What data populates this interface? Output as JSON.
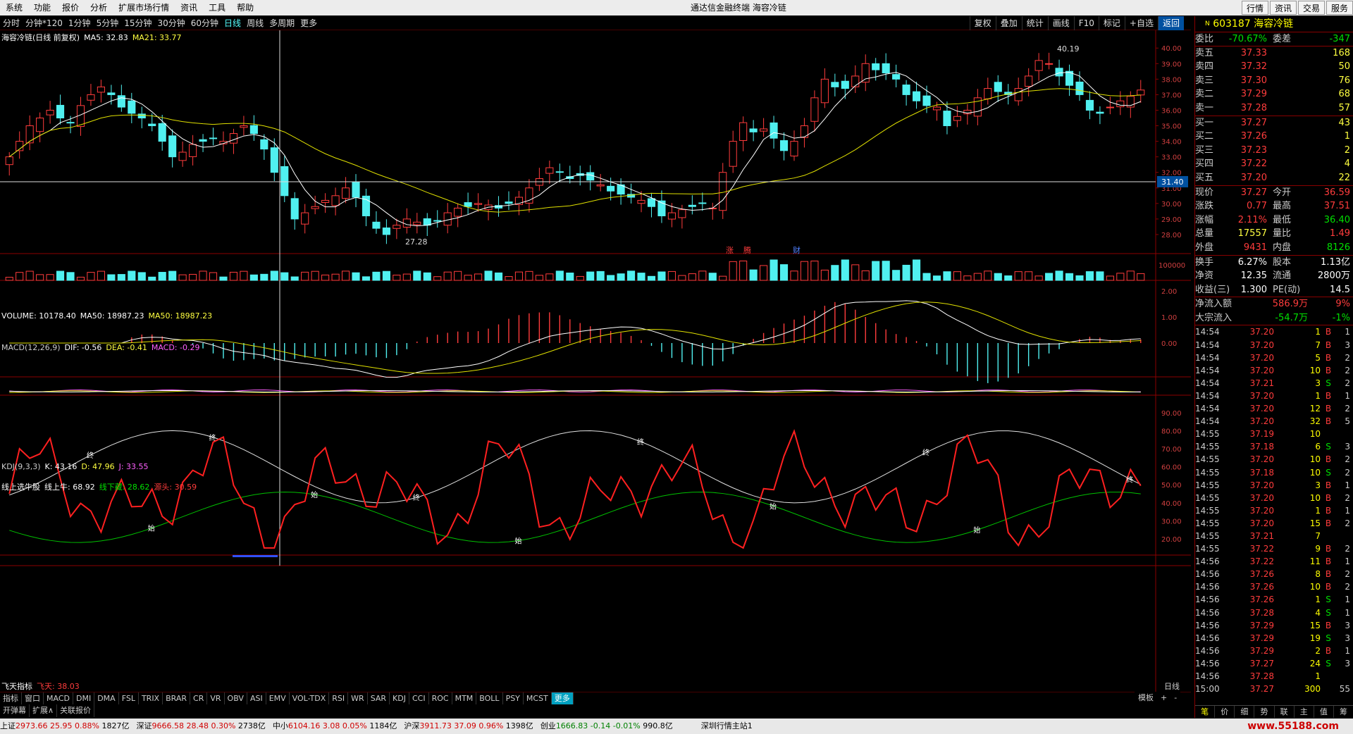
{
  "menubar": {
    "items": [
      "系统",
      "功能",
      "报价",
      "分析",
      "扩展市场行情",
      "资讯",
      "工具",
      "帮助"
    ],
    "title": "通达信金融终端  海容冷链",
    "right_buttons": [
      "行情",
      "资讯",
      "交易",
      "服务"
    ]
  },
  "periods": {
    "items": [
      "分时",
      "分钟*120",
      "1分钟",
      "5分钟",
      "15分钟",
      "30分钟",
      "60分钟",
      "日线",
      "周线",
      "多周期",
      "更多"
    ],
    "active": "日线"
  },
  "toolbar": {
    "items": [
      "复权",
      "叠加",
      "统计",
      "画线",
      "F10",
      "标记",
      "+自选",
      "返回"
    ],
    "active": "返回"
  },
  "main_chart": {
    "title_stock": "海容冷链(日线 前复权)",
    "ma5": "MA5: 32.83",
    "ma21": "MA21: 33.77",
    "price_axis": [
      "40.00",
      "39.00",
      "38.00",
      "37.00",
      "36.00",
      "35.00",
      "34.00",
      "33.00",
      "32.00",
      "31.00",
      "30.00",
      "29.00",
      "28.00"
    ],
    "cursor_price": "31.40",
    "high_label": "40.19",
    "low_label": "27.28",
    "markers": [
      "涨",
      "腾",
      "财"
    ]
  },
  "volume_panel": {
    "title": "VOLUME: 10178.40",
    "ma50a": "MA50: 18987.23",
    "ma50b": "MA50: 18987.23",
    "axis": "100000"
  },
  "macd_panel": {
    "title": "MACD(12,26,9)",
    "dif": "DIF: -0.56",
    "dea": "DEA: -0.41",
    "macd": "MACD: -0.29",
    "axis": [
      "2.00",
      "1.00",
      "0.00"
    ]
  },
  "kdj_panel": {
    "title": "KDJ(9,3,3)",
    "k": "K: 43.16",
    "d": "D: 47.96",
    "j": "J: 33.55"
  },
  "niu_panel": {
    "title": "线上选牛股",
    "up": "线上牛: 68.92",
    "down": "线下藏: 28.62",
    "head": "源头: 30.59",
    "axis": [
      "90.00",
      "80.00",
      "70.00",
      "60.00",
      "50.00",
      "40.00",
      "30.00",
      "20.00"
    ],
    "labels_start": "始",
    "labels_end": "终"
  },
  "feitian_panel": {
    "title": "飞天指标",
    "value": "飞天: 38.03"
  },
  "bottom_tabs": [
    "指标",
    "窗口",
    "MACD",
    "DMI",
    "DMA",
    "FSL",
    "TRIX",
    "BRAR",
    "CR",
    "VR",
    "OBV",
    "ASI",
    "EMV",
    "VOL-TDX",
    "RSI",
    "WR",
    "SAR",
    "KDJ",
    "CCI",
    "ROC",
    "MTM",
    "BOLL",
    "PSY",
    "MCST",
    "更多"
  ],
  "bottom_tabs_right": [
    "模板",
    "+",
    "-"
  ],
  "bottom_tabs_row2": [
    "开弹幕",
    "扩展∧",
    "关联报价"
  ],
  "period_label_right": "日线",
  "statusbar": [
    {
      "name": "上证",
      "v": "2973.66",
      "c": "25.95",
      "p": "0.88%",
      "a": "1827亿",
      "color": "red"
    },
    {
      "name": "深证",
      "v": "9666.58",
      "c": "28.48",
      "p": "0.30%",
      "a": "2738亿",
      "color": "red"
    },
    {
      "name": "中小",
      "v": "6104.16",
      "c": "3.08",
      "p": "0.05%",
      "a": "1184亿",
      "color": "red"
    },
    {
      "name": "沪深",
      "v": "3911.73",
      "c": "37.09",
      "p": "0.96%",
      "a": "1398亿",
      "color": "red"
    },
    {
      "name": "创业",
      "v": "1666.83",
      "c": "-0.14",
      "p": "-0.01%",
      "a": "990.8亿",
      "color": "green"
    }
  ],
  "status_right": "深圳行情主站1",
  "watermark": "www.55188.com",
  "side": {
    "code": "603187",
    "name": "海容冷链",
    "weibi": {
      "k": "委比",
      "v": "-70.67%",
      "k2": "委差",
      "v2": "-347"
    },
    "asks": [
      {
        "k": "卖五",
        "p": "37.33",
        "v": "168"
      },
      {
        "k": "卖四",
        "p": "37.32",
        "v": "50"
      },
      {
        "k": "卖三",
        "p": "37.30",
        "v": "76"
      },
      {
        "k": "卖二",
        "p": "37.29",
        "v": "68"
      },
      {
        "k": "卖一",
        "p": "37.28",
        "v": "57"
      }
    ],
    "bids": [
      {
        "k": "买一",
        "p": "37.27",
        "v": "43"
      },
      {
        "k": "买二",
        "p": "37.26",
        "v": "1"
      },
      {
        "k": "买三",
        "p": "37.23",
        "v": "2"
      },
      {
        "k": "买四",
        "p": "37.22",
        "v": "4"
      },
      {
        "k": "买五",
        "p": "37.20",
        "v": "22"
      }
    ],
    "quote": [
      {
        "k": "现价",
        "v": "37.27",
        "c": "red",
        "k2": "今开",
        "v2": "36.59",
        "c2": "red"
      },
      {
        "k": "涨跌",
        "v": "0.77",
        "c": "red",
        "k2": "最高",
        "v2": "37.51",
        "c2": "red"
      },
      {
        "k": "涨幅",
        "v": "2.11%",
        "c": "red",
        "k2": "最低",
        "v2": "36.40",
        "c2": "green"
      },
      {
        "k": "总量",
        "v": "17557",
        "c": "yellow",
        "k2": "量比",
        "v2": "1.49",
        "c2": "red"
      },
      {
        "k": "外盘",
        "v": "9431",
        "c": "red",
        "k2": "内盘",
        "v2": "8126",
        "c2": "green"
      }
    ],
    "quote2": [
      {
        "k": "换手",
        "v": "6.27%",
        "k2": "股本",
        "v2": "1.13亿"
      },
      {
        "k": "净资",
        "v": "12.35",
        "k2": "流通",
        "v2": "2800万"
      },
      {
        "k": "收益(三)",
        "v": "1.300",
        "k2": "PE(动)",
        "v2": "14.5"
      }
    ],
    "flows": [
      {
        "k": "净流入额",
        "v": "586.9万",
        "p": "9%",
        "c": "red"
      },
      {
        "k": "大宗流入",
        "v": "-54.7万",
        "p": "-1%",
        "c": "green"
      }
    ],
    "ticks": [
      [
        "14:54",
        "37.20",
        "1",
        "B",
        "1"
      ],
      [
        "14:54",
        "37.20",
        "7",
        "B",
        "3"
      ],
      [
        "14:54",
        "37.20",
        "5",
        "B",
        "2"
      ],
      [
        "14:54",
        "37.20",
        "10",
        "B",
        "2"
      ],
      [
        "14:54",
        "37.21",
        "3",
        "S",
        "2"
      ],
      [
        "14:54",
        "37.20",
        "1",
        "B",
        "1"
      ],
      [
        "14:54",
        "37.20",
        "12",
        "B",
        "2"
      ],
      [
        "14:54",
        "37.20",
        "32",
        "B",
        "5"
      ],
      [
        "14:55",
        "37.19",
        "10",
        "",
        ""
      ],
      [
        "14:55",
        "37.18",
        "6",
        "S",
        "3"
      ],
      [
        "14:55",
        "37.20",
        "10",
        "B",
        "2"
      ],
      [
        "14:55",
        "37.18",
        "10",
        "S",
        "2"
      ],
      [
        "14:55",
        "37.20",
        "3",
        "B",
        "1"
      ],
      [
        "14:55",
        "37.20",
        "10",
        "B",
        "2"
      ],
      [
        "14:55",
        "37.20",
        "1",
        "B",
        "1"
      ],
      [
        "14:55",
        "37.20",
        "15",
        "B",
        "2"
      ],
      [
        "14:55",
        "37.21",
        "7",
        "",
        ""
      ],
      [
        "14:55",
        "37.22",
        "9",
        "B",
        "2"
      ],
      [
        "14:56",
        "37.22",
        "11",
        "B",
        "1"
      ],
      [
        "14:56",
        "37.26",
        "8",
        "B",
        "2"
      ],
      [
        "14:56",
        "37.26",
        "10",
        "B",
        "2"
      ],
      [
        "14:56",
        "37.26",
        "1",
        "S",
        "1"
      ],
      [
        "14:56",
        "37.28",
        "4",
        "S",
        "1"
      ],
      [
        "14:56",
        "37.29",
        "15",
        "B",
        "3"
      ],
      [
        "14:56",
        "37.29",
        "19",
        "S",
        "3"
      ],
      [
        "14:56",
        "37.29",
        "2",
        "B",
        "1"
      ],
      [
        "14:56",
        "37.27",
        "24",
        "S",
        "3"
      ],
      [
        "14:56",
        "37.28",
        "1",
        "",
        ""
      ],
      [
        "15:00",
        "37.27",
        "300",
        "",
        "55"
      ]
    ],
    "tabs": [
      "笔",
      "价",
      "细",
      "势",
      "联",
      "主",
      "值",
      "筹"
    ]
  }
}
